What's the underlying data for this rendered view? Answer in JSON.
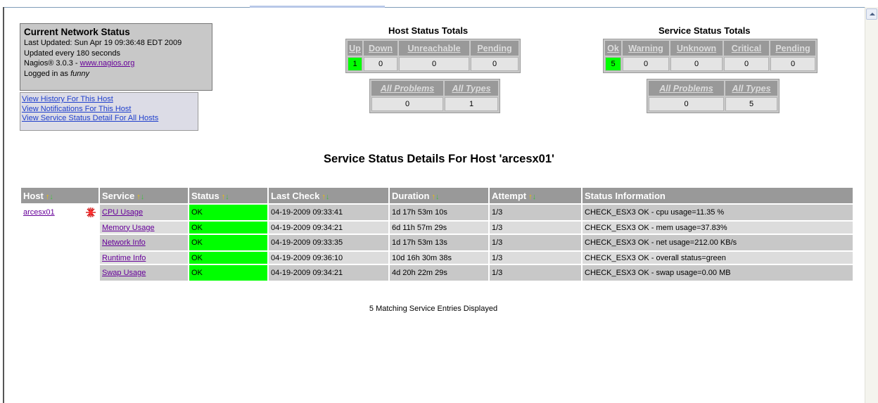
{
  "status_box": {
    "title": "Current Network Status",
    "last_updated": "Last Updated: Sun Apr 19 09:36:48 EDT 2009",
    "update_interval": "Updated every 180 seconds",
    "version_prefix": "Nagios® 3.0.3 - ",
    "version_link": "www.nagios.org",
    "logged_in_prefix": "Logged in as ",
    "user": "funny"
  },
  "links": [
    "View History For This Host",
    "View Notifications For This Host",
    "View Service Status Detail For All Hosts"
  ],
  "host_totals": {
    "title": "Host Status Totals",
    "headers": [
      "Up",
      "Down",
      "Unreachable",
      "Pending"
    ],
    "values": [
      "1",
      "0",
      "0",
      "0"
    ],
    "summary_headers": [
      "All Problems",
      "All Types"
    ],
    "summary_values": [
      "0",
      "1"
    ]
  },
  "service_totals": {
    "title": "Service Status Totals",
    "headers": [
      "Ok",
      "Warning",
      "Unknown",
      "Critical",
      "Pending"
    ],
    "values": [
      "5",
      "0",
      "0",
      "0",
      "0"
    ],
    "summary_headers": [
      "All Problems",
      "All Types"
    ],
    "summary_values": [
      "0",
      "5"
    ]
  },
  "page_title": "Service Status Details For Host 'arcesx01'",
  "table": {
    "headers": [
      "Host",
      "Service",
      "Status",
      "Last Check",
      "Duration",
      "Attempt",
      "Status Information"
    ],
    "host": "arcesx01",
    "rows": [
      {
        "service": "CPU Usage",
        "status": "OK",
        "last_check": "04-19-2009 09:33:41",
        "duration": "1d 17h 53m 10s",
        "attempt": "1/3",
        "info": "CHECK_ESX3 OK - cpu usage=11.35 %"
      },
      {
        "service": "Memory Usage",
        "status": "OK",
        "last_check": "04-19-2009 09:34:21",
        "duration": "6d 11h 57m 29s",
        "attempt": "1/3",
        "info": "CHECK_ESX3 OK - mem usage=37.83%"
      },
      {
        "service": "Network Info",
        "status": "OK",
        "last_check": "04-19-2009 09:33:35",
        "duration": "1d 17h 53m 13s",
        "attempt": "1/3",
        "info": "CHECK_ESX3 OK - net usage=212.00 KB/s"
      },
      {
        "service": "Runtime Info",
        "status": "OK",
        "last_check": "04-19-2009 09:36:10",
        "duration": "10d 16h 30m 38s",
        "attempt": "1/3",
        "info": "CHECK_ESX3 OK - overall status=green"
      },
      {
        "service": "Swap Usage",
        "status": "OK",
        "last_check": "04-19-2009 09:34:21",
        "duration": "4d 20h 22m 29s",
        "attempt": "1/3",
        "info": "CHECK_ESX3 OK - swap usage=0.00 MB"
      }
    ]
  },
  "footer": "5 Matching Service Entries Displayed",
  "colors": {
    "ok_green": "#00ff00",
    "header_gray": "#999999",
    "visited_link": "#660099",
    "link_blue": "#1f3fcc",
    "sort_up": "#f0c000",
    "sort_down": "#40c040"
  },
  "icons": {
    "sort": "sort-up-down-arrows-icon",
    "host": "host-splat-icon",
    "scroll": "scroll-up-arrow-icon"
  }
}
